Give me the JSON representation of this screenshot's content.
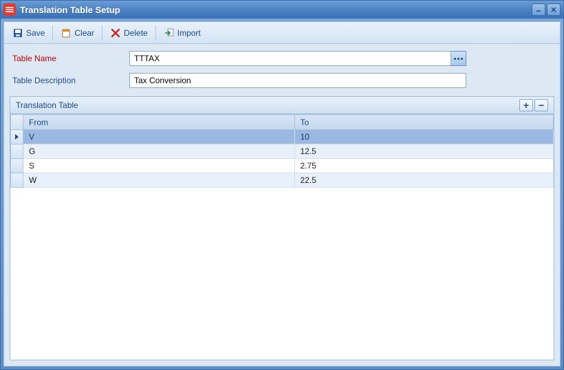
{
  "window": {
    "title": "Translation Table Setup"
  },
  "toolbar": {
    "save_label": "Save",
    "clear_label": "Clear",
    "delete_label": "Delete",
    "import_label": "Import"
  },
  "form": {
    "table_name_label": "Table Name",
    "table_name_value": "TTTAX",
    "table_desc_label": "Table Description",
    "table_desc_value": "Tax Conversion"
  },
  "panel": {
    "title": "Translation Table"
  },
  "grid": {
    "columns": {
      "from": "From",
      "to": "To"
    },
    "rows": [
      {
        "from": "V",
        "to": "10"
      },
      {
        "from": "G",
        "to": "12.5"
      },
      {
        "from": "S",
        "to": "2.75"
      },
      {
        "from": "W",
        "to": "22.5"
      }
    ]
  }
}
